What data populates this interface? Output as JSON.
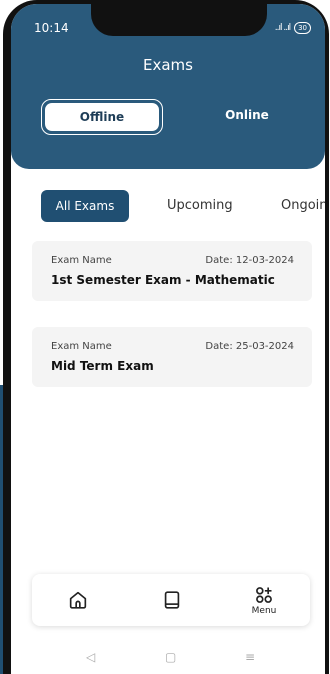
{
  "status": {
    "time": "10:14",
    "signal": "..ıl ..ıl",
    "battery": "30"
  },
  "header": {
    "title": "Exams"
  },
  "mode_toggle": {
    "offline": "Offline",
    "online": "Online"
  },
  "filters": {
    "all": "All Exams",
    "upcoming": "Upcoming",
    "ongoing": "Ongoing"
  },
  "exams": [
    {
      "label": "Exam Name",
      "date": "Date: 12-03-2024",
      "name": "1st Semester Exam - Mathematic"
    },
    {
      "label": "Exam Name",
      "date": "Date: 25-03-2024",
      "name": "Mid Term Exam"
    }
  ],
  "bottom_nav": {
    "home_icon": "home-icon",
    "book_icon": "book-icon",
    "menu_icon": "menu-grid-icon",
    "menu_label": "Menu"
  },
  "system_nav": {
    "back": "◁",
    "home": "▢",
    "recents": "≡"
  },
  "colors": {
    "primary": "#2a5a7c",
    "active_chip": "#204f72",
    "card_bg": "#f4f4f4"
  }
}
